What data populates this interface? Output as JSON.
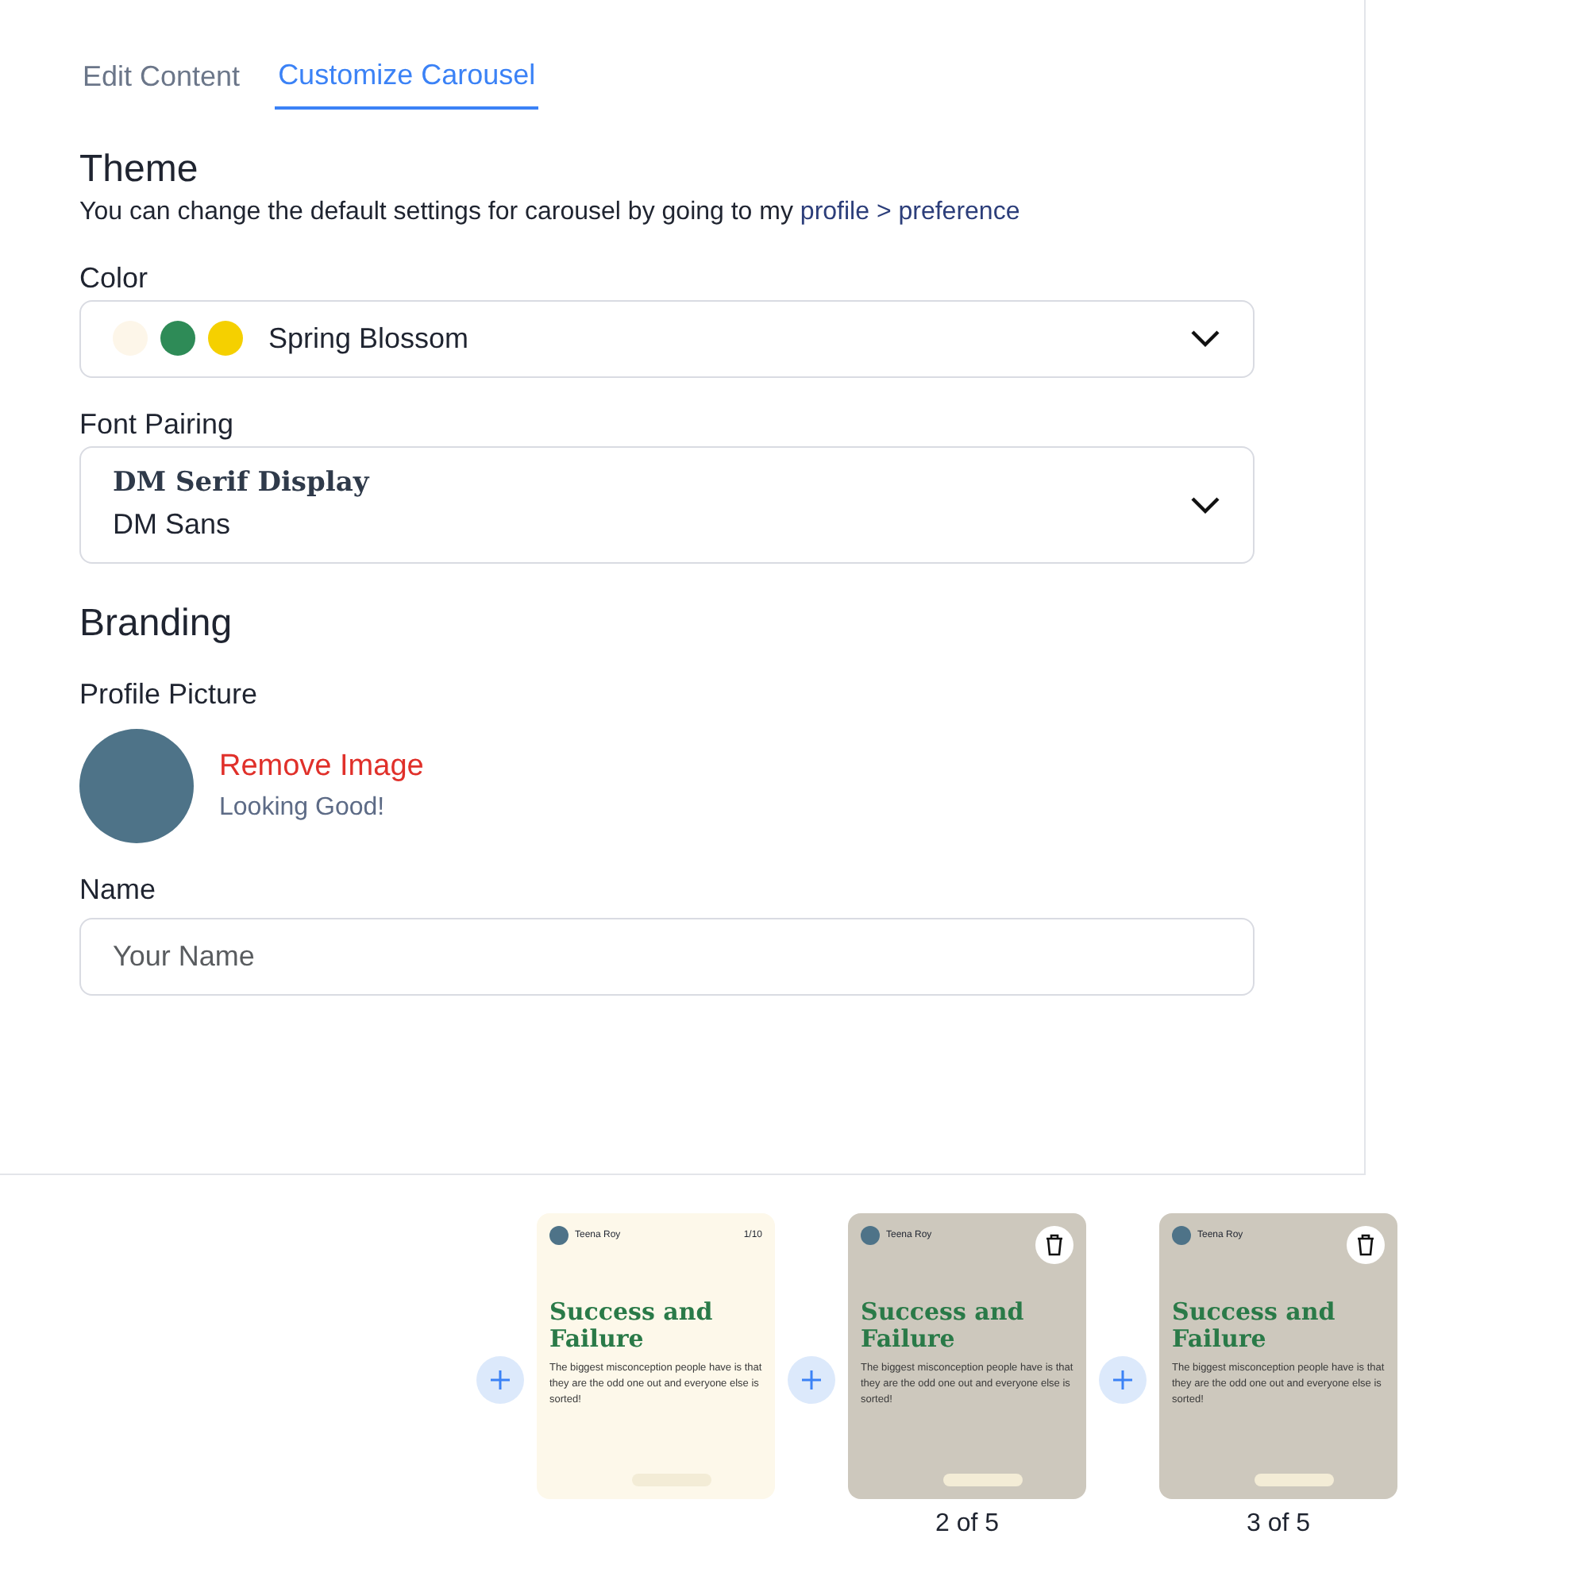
{
  "tabs": [
    {
      "label": "Edit Content",
      "selected": false
    },
    {
      "label": "Customize Carousel",
      "selected": true
    }
  ],
  "theme": {
    "title": "Theme",
    "description": "You can change the default settings for carousel by going to my",
    "link": "profile > preference",
    "color": {
      "label": "Color",
      "value": "Spring Blossom",
      "swatches": [
        {
          "color": "#fdf6e9"
        },
        {
          "color": "#2e8b57"
        },
        {
          "color": "#f5d000"
        }
      ]
    },
    "font_pairing": {
      "label": "Font Pairing",
      "heading_font": "DM Serif Display",
      "body_font": "DM Sans"
    }
  },
  "branding": {
    "title": "Branding",
    "profile_picture": {
      "label": "Profile Picture",
      "remove": "Remove Image",
      "note": "Looking Good!"
    },
    "name": {
      "label": "Name",
      "placeholder": "Your Name"
    }
  },
  "slides": [
    {
      "author": "Teena Roy",
      "page": "1/10",
      "title": "Success and Failure",
      "body": "The biggest misconception people have is that they are the odd one out and everyone else is sorted!",
      "kind": "cover",
      "deletable": false
    },
    {
      "author": "Teena Roy",
      "title": "Success and Failure",
      "body": "The biggest misconception people have is that they are the odd one out and everyone else is sorted!",
      "kind": "page",
      "deletable": true,
      "caption": "2 of 5"
    },
    {
      "author": "Teena Roy",
      "title": "Success and Failure",
      "body": "The biggest misconception people have is that they are the odd one out and everyone else is sorted!",
      "kind": "page",
      "deletable": true,
      "caption": "3 of 5"
    }
  ]
}
